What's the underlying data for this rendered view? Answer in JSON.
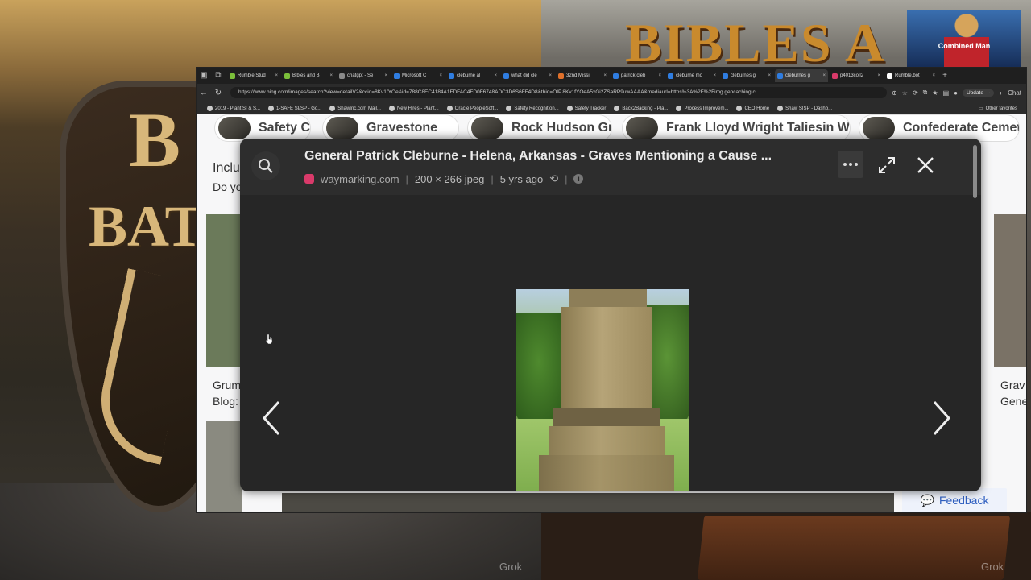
{
  "background": {
    "left_logo_text": [
      "B",
      "BATT"
    ],
    "right_banner_text": "BIBLES A",
    "avatar_name": "Combined Man",
    "watermarks": [
      "Grok",
      "Grok"
    ]
  },
  "browser": {
    "tabs": [
      {
        "label": "Rumble Stud",
        "color": "#7bbf3a",
        "active": false
      },
      {
        "label": "Bibles and B",
        "color": "#7bbf3a",
        "active": false
      },
      {
        "label": "chatgpt - Se",
        "color": "#8a8a8a",
        "active": false
      },
      {
        "label": "Microsoft C",
        "color": "#2f7de1",
        "active": false
      },
      {
        "label": "cleburne al",
        "color": "#2f7de1",
        "active": false
      },
      {
        "label": "what did cle",
        "color": "#2f7de1",
        "active": false
      },
      {
        "label": "32nd Missi",
        "color": "#e0702a",
        "active": false
      },
      {
        "label": "patrick cleb",
        "color": "#2f7de1",
        "active": false
      },
      {
        "label": "cleburne mo",
        "color": "#2f7de1",
        "active": false
      },
      {
        "label": "cleburnes g",
        "color": "#2f7de1",
        "active": false
      },
      {
        "label": "cleburnes g",
        "color": "#2f7de1",
        "active": true
      },
      {
        "label": "p4013coll2",
        "color": "#d93a6a",
        "active": false
      },
      {
        "label": "Rumble.bot",
        "color": "#ffffff",
        "active": false
      }
    ],
    "url": "https://www.bing.com/images/search?view=detailV2&ccid=8Kv1fYOe&id=788C8EC4184A1FDFAC4FD0F6748ADC3D6S6FF4D8&thid=OIP.8Kv1fYOeA5xGi2ZSaRP9uwAAAA&mediaurl=https%3A%2F%2Fimg.geocaching.c...",
    "update_label": "Update",
    "chat_label": "Chat",
    "bookmarks": [
      "2019 - Plant SI & S...",
      "1-SAFE SI/SP - Go...",
      "ShawInc.com Mail...",
      "New Hires - Plant...",
      "Oracle PeopleSoft...",
      "Safety Recognition...",
      "Safety Tracker",
      "Back2Backing - Pla...",
      "Process Improvem...",
      "CEO Home",
      "Shaw SISP - Dashb..."
    ],
    "other_favorites": "Other favorites"
  },
  "page": {
    "chips": [
      {
        "label": "Safety Coffin"
      },
      {
        "label": "Gravestone"
      },
      {
        "label": "Rock Hudson Grave"
      },
      {
        "label": "Frank Lloyd Wright Taliesin Wisconsin"
      },
      {
        "label": "Confederate Cemetery"
      }
    ],
    "left_text_1": "Inclu",
    "left_text_2": "Do yo",
    "left_caption_1": "Grum",
    "left_caption_2": "Blog:",
    "right_caption_1": "Grav",
    "right_caption_2": "Gene",
    "feedback_label": "Feedback"
  },
  "modal": {
    "title": "General Patrick Cleburne - Helena, Arkansas - Graves Mentioning a Cause ...",
    "source": "waymarking.com",
    "dimensions": "200 × 266 jpeg",
    "age": "5 yrs ago",
    "separator": "|"
  }
}
